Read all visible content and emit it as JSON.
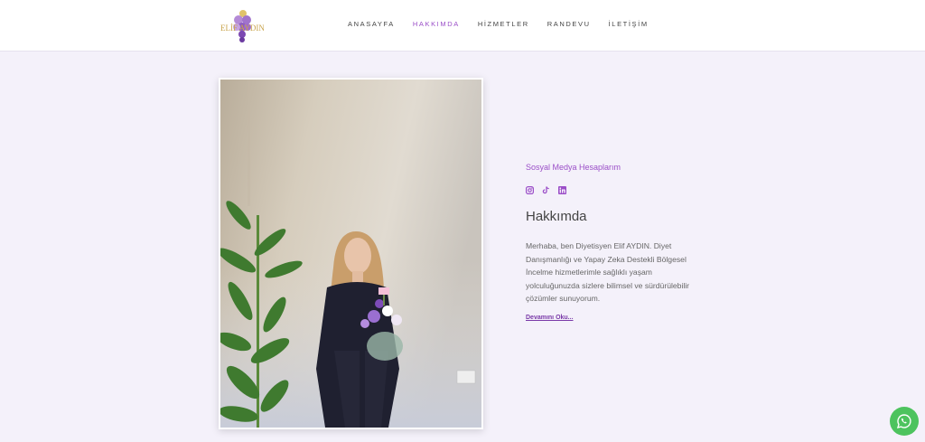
{
  "header": {
    "logo_text": "ELİF AYDIN",
    "nav": [
      {
        "label": "ANASAYFA",
        "active": false
      },
      {
        "label": "HAKKIMDA",
        "active": true
      },
      {
        "label": "HİZMETLER",
        "active": false
      },
      {
        "label": "RANDEVU",
        "active": false
      },
      {
        "label": "İLETİŞİM",
        "active": false
      }
    ]
  },
  "about": {
    "social_title": "Sosyal Medya Hesaplarım",
    "social_icons": [
      "instagram-icon",
      "tiktok-icon",
      "linkedin-icon"
    ],
    "heading": "Hakkımda",
    "paragraph": "Merhaba, ben Diyetisyen Elif AYDIN. Diyet Danışmanlığı ve Yapay Zeka Destekli Bölgesel İncelme hizmetlerimle sağlıklı yaşam yolculuğunuzda sizlere bilimsel ve sürdürülebilir çözümler sunuyorum.",
    "read_more": "Devamını Oku..."
  },
  "colors": {
    "accent": "#9b4fc8",
    "background": "#f4f1fa",
    "whatsapp": "#4dc35e"
  },
  "floating": {
    "whatsapp_icon": "whatsapp-icon"
  }
}
